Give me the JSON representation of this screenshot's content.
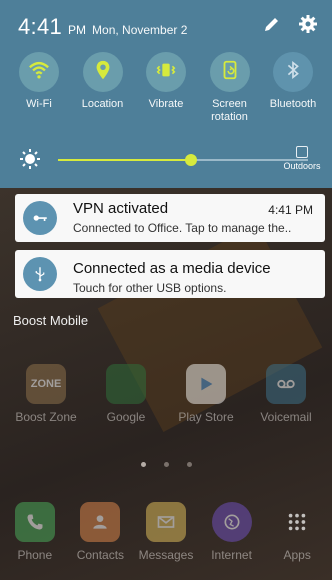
{
  "status": {
    "time": "4:41",
    "ampm": "PM",
    "date": "Mon, November 2"
  },
  "quick_toggles": [
    {
      "label": "Wi-Fi",
      "icon": "wifi-icon",
      "state": "on"
    },
    {
      "label": "Location",
      "icon": "location-pin-icon",
      "state": "on"
    },
    {
      "label": "Vibrate",
      "icon": "vibrate-icon",
      "state": "on"
    },
    {
      "label": "Screen\nrotation",
      "icon": "screen-rotation-icon",
      "state": "on"
    },
    {
      "label": "Bluetooth",
      "icon": "bluetooth-icon",
      "state": "off"
    }
  ],
  "brightness": {
    "level": 0.53,
    "outdoors_label": "Outdoors"
  },
  "notifications": [
    {
      "title": "VPN activated",
      "time": "4:41 PM",
      "text": "Connected to Office. Tap to manage the..",
      "icon": "vpn-key-icon"
    },
    {
      "title": "Connected as a media device",
      "time": "",
      "text": "Touch for other USB options.",
      "icon": "usb-icon"
    }
  ],
  "carrier": "Boost Mobile",
  "home_apps": [
    {
      "label": "Boost Zone",
      "icon": "boost-zone-icon"
    },
    {
      "label": "Google",
      "icon": "google-folder-icon"
    },
    {
      "label": "Play Store",
      "icon": "play-store-icon"
    },
    {
      "label": "Voicemail",
      "icon": "voicemail-icon"
    }
  ],
  "dock_apps": [
    {
      "label": "Phone",
      "icon": "phone-icon"
    },
    {
      "label": "Contacts",
      "icon": "contacts-icon"
    },
    {
      "label": "Messages",
      "icon": "messages-icon"
    },
    {
      "label": "Internet",
      "icon": "internet-icon"
    },
    {
      "label": "Apps",
      "icon": "apps-grid-icon"
    }
  ]
}
